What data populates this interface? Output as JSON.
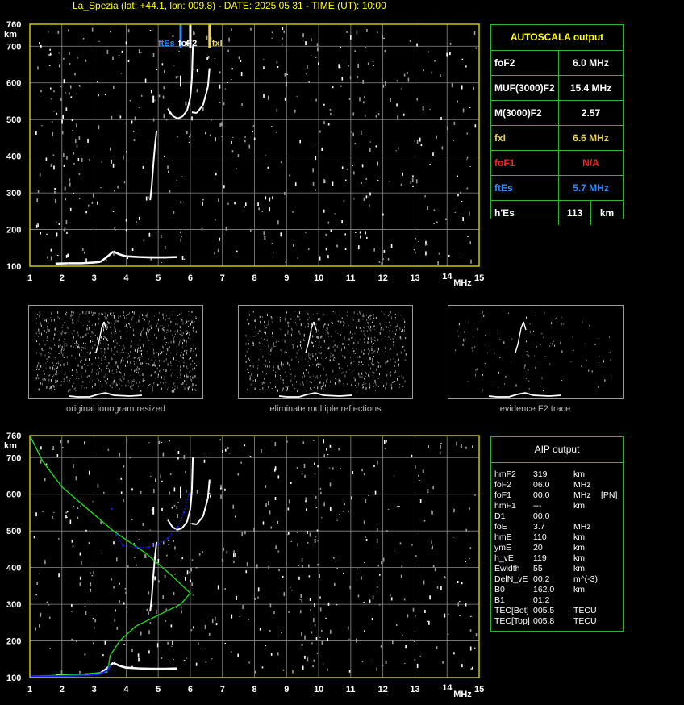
{
  "header": {
    "title": "La_Spezia (lat: +44.1, lon: 009.8) - DATE: 2025 05 31 - TIME (UT): 10:00"
  },
  "plot": {
    "y_ticks": [
      "760",
      "700",
      "600",
      "500",
      "400",
      "300",
      "200",
      "100"
    ],
    "y_unit": "km",
    "x_ticks": [
      "1",
      "2",
      "3",
      "4",
      "5",
      "6",
      "7",
      "8",
      "9",
      "10",
      "11",
      "12",
      "13",
      "14",
      "15"
    ],
    "x_unit": "MHz",
    "markers": {
      "ftEs": "ftEs",
      "foF2": "foF2",
      "fxI": "fxI"
    }
  },
  "thumbs": {
    "captions": [
      "original ionogram resized",
      "eliminate multiple reflections",
      "evidence F2 trace"
    ]
  },
  "autoscala": {
    "title": "AUTOSCALA output",
    "rows": [
      {
        "key": "foF2",
        "value": "6.0 MHz"
      },
      {
        "key": "MUF(3000)F2",
        "value": "15.4 MHz"
      },
      {
        "key": "M(3000)F2",
        "value": "2.57"
      },
      {
        "key": "fxI",
        "value": "6.6 MHz"
      },
      {
        "key": "foF1",
        "value": "N/A"
      },
      {
        "key": "ftEs",
        "value": "5.7 MHz"
      },
      {
        "key": "h'Es",
        "value": "113",
        "unit": "km"
      }
    ]
  },
  "aip": {
    "title": "AIP output",
    "rows": [
      [
        "hmF2",
        "319",
        "km",
        ""
      ],
      [
        "foF2",
        "06.0",
        "MHz",
        ""
      ],
      [
        "foF1",
        "00.0",
        "MHz",
        "[PN]"
      ],
      [
        "hmF1",
        "---",
        "km",
        ""
      ],
      [
        "D1",
        "00.0",
        "",
        ""
      ],
      [
        "foE",
        "3.7",
        "MHz",
        ""
      ],
      [
        "hmE",
        "110",
        "km",
        ""
      ],
      [
        "ymE",
        "20",
        "km",
        ""
      ],
      [
        "h_vE",
        "119",
        "km",
        ""
      ],
      [
        "Ewidth",
        "55",
        "km",
        ""
      ],
      [
        "DelN_vE",
        "00.2",
        "m^(-3)",
        ""
      ],
      [
        "B0",
        "162.0",
        "km",
        ""
      ],
      [
        "B1",
        "01.2",
        "",
        ""
      ],
      [
        "TEC[Bot]",
        "005.5",
        "TECU",
        ""
      ],
      [
        "TEC[Top]",
        "005.8",
        "TECU",
        ""
      ]
    ]
  },
  "colors": {
    "title": "#ffff00",
    "frame": "#c8c800",
    "grid": "#8a8a8a",
    "table_border": "#2db52d",
    "foF2": "#ffffff",
    "fxI": "#e6d35a",
    "foF1": "#ff2020",
    "ftEs": "#2e8cff",
    "profile_green": "#1fd31f",
    "profile_blue": "#1a1aff"
  }
}
